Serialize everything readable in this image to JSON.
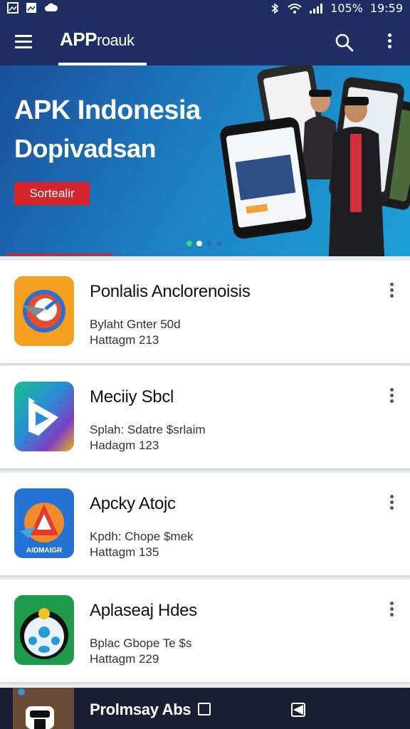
{
  "status_bar": {
    "battery": "105%",
    "time": "19:59"
  },
  "app_bar": {
    "brand_prefix": "APP",
    "brand_suffix": "roauk"
  },
  "hero": {
    "title": "APK Indonesia",
    "subtitle": "Dopivadsan",
    "button_label": "Sortealir"
  },
  "apps": [
    {
      "title": "Ponlalis Anclorenoisis",
      "line1": "Bylaht Gnter 50d",
      "line2": "Hattagm 213"
    },
    {
      "title": "Meciiy Sbcl",
      "line1": "Splah: Sdatre $srlaim",
      "line2": "Hadagm 123"
    },
    {
      "title": "Apcky Atojc",
      "line1": "Kpdh: Chope $mek",
      "line2": "Hattagm 135"
    },
    {
      "title": "Aplaseaj Hdes",
      "line1": "Bplac Gbope Te $s",
      "line2": "Hattagm 229"
    }
  ],
  "app3_icon_text": "AIDMAIGR",
  "bottom_bar": {
    "title": "Prolmsay Abs"
  },
  "colors": {
    "app_bar": "#1f2f66",
    "accent_red": "#d6262b",
    "hero_blue": "#1d82c4"
  }
}
